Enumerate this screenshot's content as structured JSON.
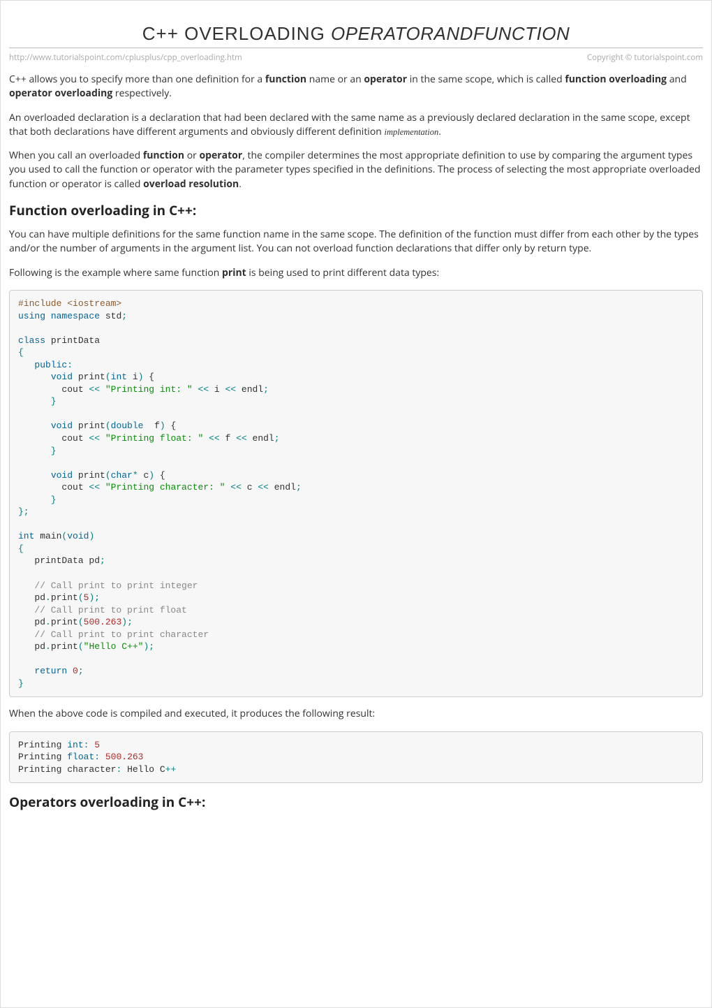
{
  "title": {
    "main": "C++ OVERLOADING ",
    "sub": "OPERATORANDFUNCTION"
  },
  "meta": {
    "url": "http://www.tutorialspoint.com/cplusplus/cpp_overloading.htm",
    "copyright": "Copyright © tutorialspoint.com"
  },
  "para1": {
    "t1": "C++ allows you to specify more than one definition for a ",
    "b1": "function",
    "t2": " name or an ",
    "b2": "operator",
    "t3": " in the same scope, which is called ",
    "b3": "function overloading",
    "t4": " and ",
    "b4": "operator overloading",
    "t5": " respectively."
  },
  "para2": {
    "t1": "An overloaded declaration is a declaration that had been declared with the same name as a previously declared declaration in the same scope, except that both declarations have different arguments and obviously different definition ",
    "i1": "implementation",
    "t2": "."
  },
  "para3": {
    "t1": "When you call an overloaded ",
    "b1": "function",
    "t2": " or ",
    "b2": "operator",
    "t3": ", the compiler determines the most appropriate definition to use by comparing the argument types you used to call the function or operator with the parameter types specified in the definitions. The process of selecting the most appropriate overloaded function or operator is called ",
    "b3": "overload resolution",
    "t4": "."
  },
  "h2a": "Function overloading in C++:",
  "para4": "You can have multiple definitions for the same function name in the same scope. The definition of the function must differ from each other by the types and/or the number of arguments in the argument list. You can not overload function declarations that differ only by return type.",
  "para5": {
    "t1": "Following is the example where same function ",
    "b1": "print",
    "t2": " is being used to print different data types:"
  },
  "code1": {
    "l01a": "#include <iostream>",
    "l02a": "using",
    "l02b": " ",
    "l02c": "namespace",
    "l02d": " std",
    "l02e": ";",
    "l03": "",
    "l04a": "class",
    "l04b": " printData",
    "l05": "{",
    "l06a": "   ",
    "l06b": "public",
    "l06c": ":",
    "l07a": "      ",
    "l07b": "void",
    "l07c": " print",
    "l07d": "(",
    "l07e": "int",
    "l07f": " i",
    "l07g": ")",
    "l07h": " {",
    "l08a": "        cout ",
    "l08b": "<<",
    "l08c": " ",
    "l08d": "\"Printing int: \"",
    "l08e": " ",
    "l08f": "<<",
    "l08g": " i ",
    "l08h": "<<",
    "l08i": " endl",
    "l08j": ";",
    "l09": "      }",
    "l10": "",
    "l11a": "      ",
    "l11b": "void",
    "l11c": " print",
    "l11d": "(",
    "l11e": "double",
    "l11f": "  f",
    "l11g": ")",
    "l11h": " {",
    "l12a": "        cout ",
    "l12b": "<<",
    "l12c": " ",
    "l12d": "\"Printing float: \"",
    "l12e": " ",
    "l12f": "<<",
    "l12g": " f ",
    "l12h": "<<",
    "l12i": " endl",
    "l12j": ";",
    "l13": "      }",
    "l14": "",
    "l15a": "      ",
    "l15b": "void",
    "l15c": " print",
    "l15d": "(",
    "l15e": "char",
    "l15f": "*",
    "l15g": " c",
    "l15h": ")",
    "l15i": " {",
    "l16a": "        cout ",
    "l16b": "<<",
    "l16c": " ",
    "l16d": "\"Printing character: \"",
    "l16e": " ",
    "l16f": "<<",
    "l16g": " c ",
    "l16h": "<<",
    "l16i": " endl",
    "l16j": ";",
    "l17": "      }",
    "l18": "};",
    "l19": "",
    "l20a": "int",
    "l20b": " main",
    "l20c": "(",
    "l20d": "void",
    "l20e": ")",
    "l21": "{",
    "l22a": "   printData pd",
    "l22b": ";",
    "l23": "",
    "l24": "   // Call print to print integer",
    "l25a": "   pd",
    "l25b": ".",
    "l25c": "print",
    "l25d": "(",
    "l25e": "5",
    "l25f": ");",
    "l26": "   // Call print to print float",
    "l27a": "   pd",
    "l27b": ".",
    "l27c": "print",
    "l27d": "(",
    "l27e": "500.263",
    "l27f": ");",
    "l28": "   // Call print to print character",
    "l29a": "   pd",
    "l29b": ".",
    "l29c": "print",
    "l29d": "(",
    "l29e": "\"Hello C++\"",
    "l29f": ");",
    "l30": "",
    "l31a": "   ",
    "l31b": "return",
    "l31c": " ",
    "l31d": "0",
    "l31e": ";",
    "l32": "}"
  },
  "para6": "When the above code is compiled and executed, it produces the following result:",
  "code2": {
    "l1a": "Printing",
    "l1b": " ",
    "l1c": "int",
    "l1d": ":",
    "l1e": " ",
    "l1f": "5",
    "l2a": "Printing",
    "l2b": " ",
    "l2c": "float",
    "l2d": ":",
    "l2e": " ",
    "l2f": "500.263",
    "l3a": "Printing",
    "l3b": " character",
    "l3c": ":",
    "l3d": " ",
    "l3e": "Hello",
    "l3f": " C",
    "l3g": "++"
  },
  "h2b": "Operators overloading in C++:"
}
